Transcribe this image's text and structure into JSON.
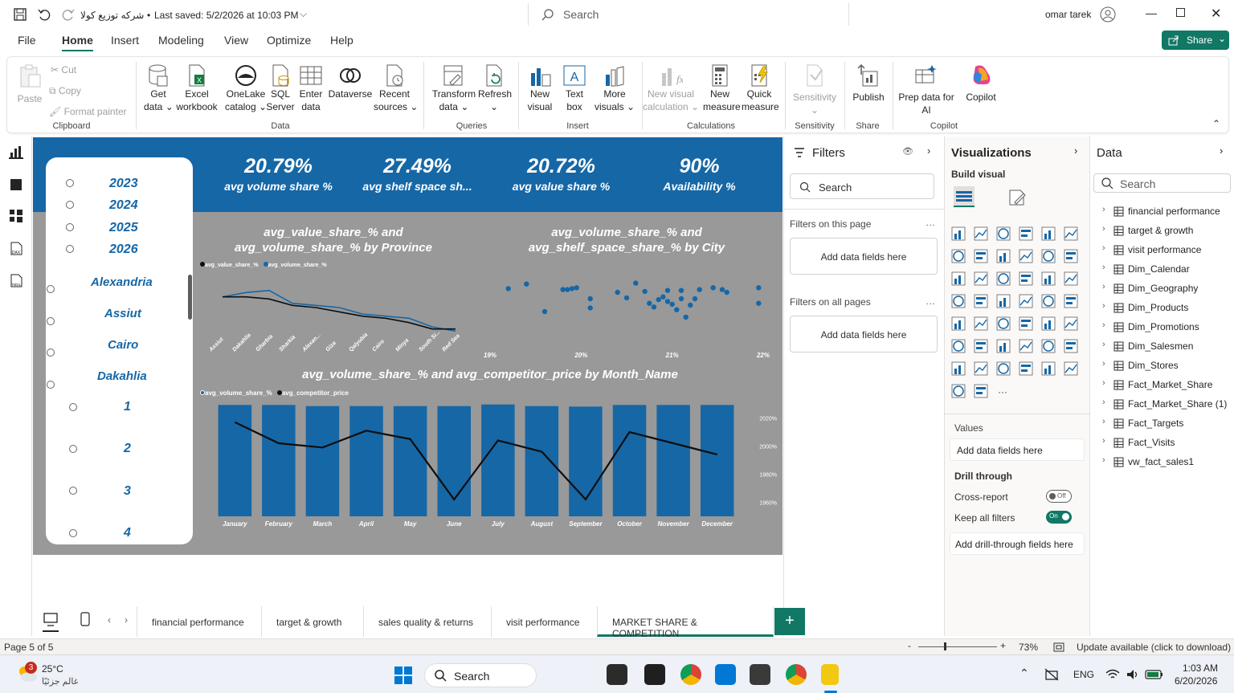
{
  "titlebar": {
    "file_name": "شركه توزيع كولا",
    "saved": "Last saved: 5/2/2026 at 10:03 PM",
    "search": "Search",
    "user": "omar tarek"
  },
  "menu": [
    "File",
    "Home",
    "Insert",
    "Modeling",
    "View",
    "Optimize",
    "Help"
  ],
  "share_label": "Share",
  "ribbon": {
    "clipboard": {
      "paste": "Paste",
      "cut": "Cut",
      "copy": "Copy",
      "format_painter": "Format painter",
      "group": "Clipboard"
    },
    "data": {
      "get_data": [
        "Get",
        "data"
      ],
      "excel": [
        "Excel",
        "workbook"
      ],
      "onelake": [
        "OneLake",
        "catalog"
      ],
      "sql": [
        "SQL",
        "Server"
      ],
      "enter": [
        "Enter",
        "data"
      ],
      "dataverse": "Dataverse",
      "recent": [
        "Recent",
        "sources"
      ],
      "group": "Data"
    },
    "queries": {
      "transform": [
        "Transform",
        "data"
      ],
      "refresh": "Refresh",
      "group": "Queries"
    },
    "insert": {
      "new_visual": [
        "New",
        "visual"
      ],
      "text_box": [
        "Text",
        "box"
      ],
      "more_visuals": [
        "More",
        "visuals"
      ],
      "group": "Insert"
    },
    "calculations": {
      "new_visual_calc": [
        "New visual",
        "calculation"
      ],
      "new_measure": [
        "New",
        "measure"
      ],
      "quick_measure": [
        "Quick",
        "measure"
      ],
      "group": "Calculations"
    },
    "sensitivity": {
      "label": "Sensitivity",
      "group": "Sensitivity"
    },
    "share": {
      "publish": "Publish",
      "group": "Share"
    },
    "copilot": {
      "prep": [
        "Prep data for",
        "AI"
      ],
      "copilot": "Copilot",
      "group": "Copilot"
    }
  },
  "kpis": [
    {
      "value": "20.79%",
      "label": "avg volume share %"
    },
    {
      "value": "27.49%",
      "label": "avg shelf space sh..."
    },
    {
      "value": "20.72%",
      "label": "avg value share %"
    },
    {
      "value": "90%",
      "label": "Availability %"
    }
  ],
  "slicer": {
    "years": [
      "2023",
      "2024",
      "2025",
      "2026"
    ],
    "provinces": [
      "Alexandria",
      "Assiut",
      "Cairo",
      "Dakahlia"
    ],
    "numbers": [
      "1",
      "2",
      "3",
      "4"
    ]
  },
  "colors": {
    "accent": "#1667a6",
    "line": "#0e0e0e",
    "canvas": "#999999"
  },
  "chart_data": [
    {
      "type": "line",
      "title": [
        "avg_value_share_% and",
        "avg_volume_share_% by Province"
      ],
      "legend": [
        "avg_value_share_%",
        "avg_volume_share_%"
      ],
      "legend_position": "top-left",
      "categories": [
        "Assiut",
        "Dakahlia",
        "Gharbia",
        "Sharkia",
        "Alexan...",
        "Giza",
        "Qalyubia",
        "Cairo",
        "Minya",
        "South Si...",
        "Red Sea"
      ],
      "series": [
        {
          "name": "avg_value_share_%",
          "color": "#0e0e0e",
          "values": [
            21.5,
            21.5,
            21.4,
            21.1,
            21.0,
            20.8,
            20.6,
            20.5,
            20.3,
            20.0,
            20.0
          ]
        },
        {
          "name": "avg_volume_share_%",
          "color": "#1667a6",
          "values": [
            21.5,
            21.7,
            21.8,
            21.2,
            21.1,
            21.0,
            20.7,
            20.6,
            20.5,
            20.1,
            19.9
          ]
        }
      ],
      "ylim": [
        19.5,
        22.5
      ]
    },
    {
      "type": "scatter",
      "title": [
        "avg_volume_share_% and",
        "avg_shelf_space_share_% by City"
      ],
      "xticks": [
        "19%",
        "20%",
        "21%",
        "22%"
      ],
      "xlim": [
        19,
        22
      ],
      "ylim": [
        24,
        31
      ],
      "points": [
        [
          19.2,
          29.3
        ],
        [
          19.4,
          29.8
        ],
        [
          19.6,
          26.8
        ],
        [
          19.8,
          29.2
        ],
        [
          19.85,
          29.2
        ],
        [
          19.9,
          29.3
        ],
        [
          19.95,
          29.4
        ],
        [
          20.1,
          28.2
        ],
        [
          20.1,
          27.2
        ],
        [
          20.4,
          28.9
        ],
        [
          20.5,
          28.3
        ],
        [
          20.6,
          29.9
        ],
        [
          20.7,
          29.0
        ],
        [
          20.75,
          27.7
        ],
        [
          20.8,
          27.3
        ],
        [
          20.85,
          28.1
        ],
        [
          20.9,
          28.4
        ],
        [
          20.95,
          27.9
        ],
        [
          20.95,
          29.1
        ],
        [
          21.0,
          27.6
        ],
        [
          21.05,
          27.0
        ],
        [
          21.1,
          28.2
        ],
        [
          21.1,
          29.1
        ],
        [
          21.15,
          26.2
        ],
        [
          21.2,
          27.5
        ],
        [
          21.25,
          28.2
        ],
        [
          21.3,
          29.2
        ],
        [
          21.45,
          29.4
        ],
        [
          21.55,
          29.2
        ],
        [
          21.6,
          28.9
        ],
        [
          21.95,
          29.4
        ],
        [
          21.95,
          27.7
        ]
      ]
    },
    {
      "type": "bar+line",
      "title": "avg_volume_share_% and avg_competitor_price by Month_Name",
      "legend": [
        "avg_volume_share_%",
        "avg_competitor_price"
      ],
      "legend_position": "top-left",
      "categories": [
        "January",
        "February",
        "March",
        "April",
        "May",
        "June",
        "July",
        "August",
        "September",
        "October",
        "November",
        "December"
      ],
      "bar_series": {
        "name": "avg_volume_share_%",
        "color": "#1667a6",
        "values": [
          20.8,
          20.8,
          20.6,
          20.6,
          20.6,
          20.6,
          20.9,
          20.6,
          20.5,
          20.8,
          20.8,
          20.8
        ],
        "ylim": [
          0,
          21
        ]
      },
      "line_series": {
        "name": "avg_competitor_price",
        "color": "#0e0e0e",
        "values": [
          2017,
          2002,
          1999,
          2011,
          2005,
          1962,
          2004,
          1996,
          1962,
          2010,
          2002,
          1994
        ]
      },
      "yticks": [
        "2020%",
        "2000%",
        "1980%",
        "1960%"
      ],
      "ylim": [
        1950,
        2030
      ]
    }
  ],
  "filters": {
    "title": "Filters",
    "search": "Search",
    "on_page": "Filters on this page",
    "all_pages": "Filters on all pages",
    "add": "Add data fields here"
  },
  "viz": {
    "title": "Visualizations",
    "build": "Build visual",
    "values": "Values",
    "add": "Add data fields here",
    "drill": "Drill through",
    "cross": "Cross-report",
    "cross_state": "Off",
    "keep": "Keep all filters",
    "keep_state": "On",
    "drill_add": "Add drill-through fields here"
  },
  "data_pane": {
    "title": "Data",
    "search": "Search",
    "fields": [
      "financial performance",
      "target & growth",
      "visit performance",
      "Dim_Calendar",
      "Dim_Geography",
      "Dim_Products",
      "Dim_Promotions",
      "Dim_Salesmen",
      "Dim_Stores",
      "Fact_Market_Share",
      "Fact_Market_Share (1)",
      "Fact_Targets",
      "Fact_Visits",
      "vw_fact_sales1"
    ]
  },
  "tabs": [
    "financial performance",
    "target & growth",
    "sales quality & returns",
    "visit performance",
    "MARKET SHARE & COMPETITION"
  ],
  "status": {
    "page": "Page 5 of 5",
    "zoom": "73%",
    "update": "Update available (click to download)"
  },
  "taskbar": {
    "temp": "25°C",
    "weather": "غالم جزئيًا",
    "badge": "3",
    "search": "Search",
    "lang": "ENG",
    "time": "1:03 AM",
    "date": "6/20/2026"
  }
}
